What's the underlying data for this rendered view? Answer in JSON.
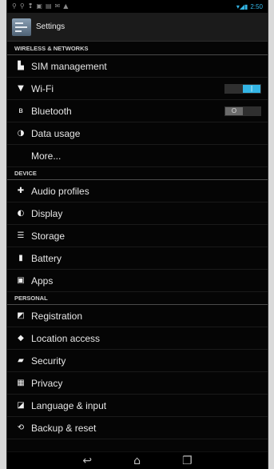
{
  "status_bar": {
    "left_icons": [
      "⚲",
      "⚲",
      "❢",
      "▣",
      "▤",
      "✉",
      "▲"
    ],
    "signal_icons": "▾◢▮",
    "time": "2:50"
  },
  "action_bar": {
    "title": "Settings"
  },
  "sections": [
    {
      "header": "WIRELESS & NETWORKS",
      "items": [
        {
          "label": "SIM management",
          "icon": "sim-icon",
          "glyph": "▙"
        },
        {
          "label": "Wi-Fi",
          "icon": "wifi-icon",
          "glyph": "▼",
          "toggle": "on"
        },
        {
          "label": "Bluetooth",
          "icon": "bluetooth-icon",
          "glyph": "ʙ",
          "toggle": "off"
        },
        {
          "label": "Data usage",
          "icon": "data-usage-icon",
          "glyph": "◑"
        },
        {
          "label": "More...",
          "icon": "",
          "glyph": ""
        }
      ]
    },
    {
      "header": "DEVICE",
      "items": [
        {
          "label": "Audio profiles",
          "icon": "audio-profiles-icon",
          "glyph": "✚"
        },
        {
          "label": "Display",
          "icon": "display-icon",
          "glyph": "◐"
        },
        {
          "label": "Storage",
          "icon": "storage-icon",
          "glyph": "☰"
        },
        {
          "label": "Battery",
          "icon": "battery-icon",
          "glyph": "▮"
        },
        {
          "label": "Apps",
          "icon": "apps-icon",
          "glyph": "▣"
        }
      ]
    },
    {
      "header": "PERSONAL",
      "items": [
        {
          "label": "Registration",
          "icon": "registration-icon",
          "glyph": "◩"
        },
        {
          "label": "Location access",
          "icon": "location-icon",
          "glyph": "◆"
        },
        {
          "label": "Security",
          "icon": "lock-icon",
          "glyph": "▰"
        },
        {
          "label": "Privacy",
          "icon": "privacy-icon",
          "glyph": "▦"
        },
        {
          "label": "Language & input",
          "icon": "language-icon",
          "glyph": "◪"
        },
        {
          "label": "Backup & reset",
          "icon": "backup-icon",
          "glyph": "⟲"
        }
      ]
    }
  ],
  "nav_bar": {
    "back_glyph": "↩",
    "home_glyph": "⌂",
    "recents_glyph": "❐"
  },
  "colors": {
    "accent": "#33b5e5",
    "background": "#050505"
  }
}
